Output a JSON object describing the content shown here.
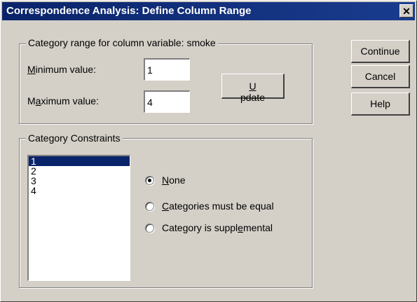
{
  "window": {
    "title": "Correspondence Analysis: Define Column Range",
    "close_glyph": "✕"
  },
  "range_group": {
    "legend": "Category range for column variable:  smoke",
    "min_label": "Minimum value:",
    "min_value": "1",
    "max_label": "Maximum value:",
    "max_value": "4",
    "update_label": "Update"
  },
  "buttons": {
    "continue": "Continue",
    "cancel": "Cancel",
    "help": "Help"
  },
  "constraints_group": {
    "legend": "Category Constraints",
    "categories": [
      "1",
      "2",
      "3",
      "4"
    ],
    "selected_index": 0,
    "options": [
      {
        "label": "None",
        "checked": true
      },
      {
        "label": "Categories must be equal",
        "checked": false
      },
      {
        "label": "Category is supplemental",
        "checked": false
      }
    ]
  }
}
